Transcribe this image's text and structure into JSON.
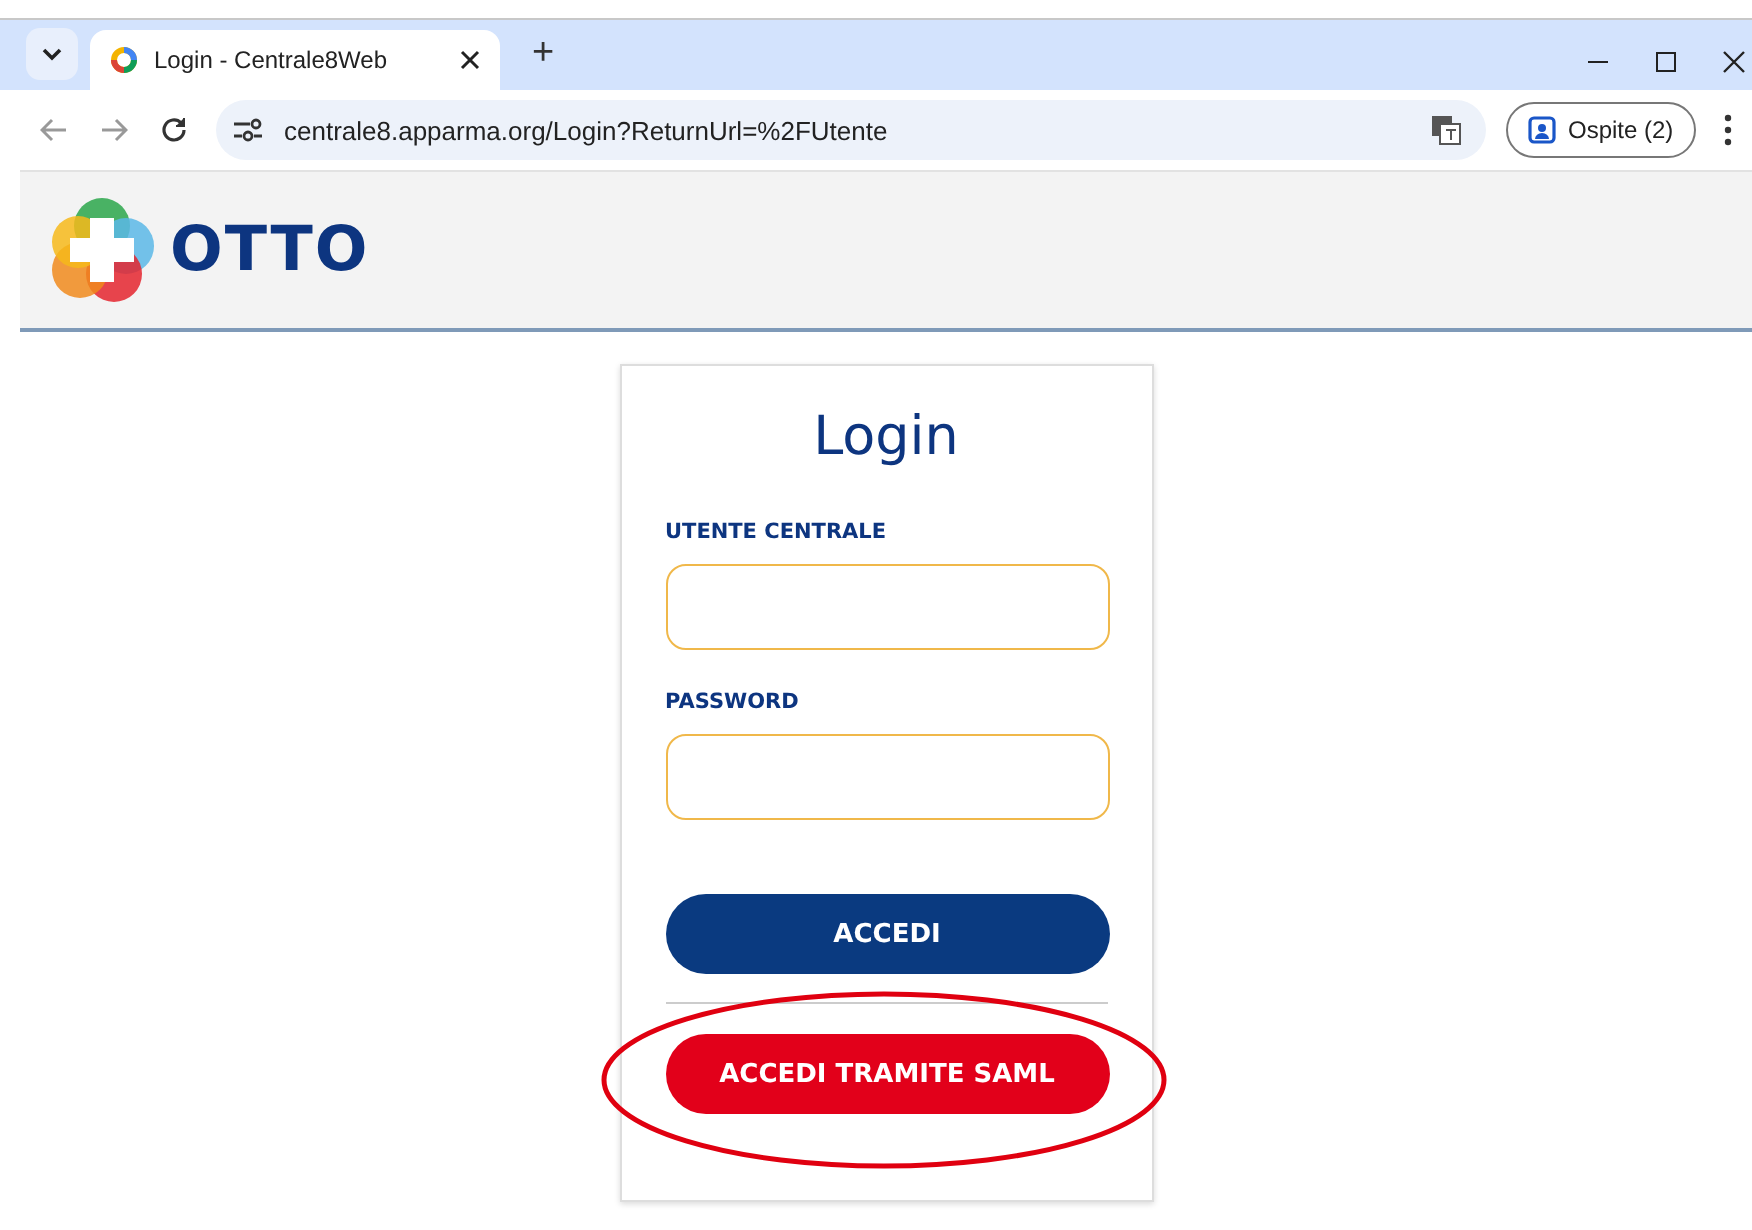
{
  "browser": {
    "tab": {
      "title": "Login - Centrale8Web",
      "selected": true
    },
    "new_tab": "+",
    "address": "centrale8.apparma.org/Login?ReturnUrl=%2FUtente",
    "profile": "Ospite (2)"
  },
  "header": {
    "logo_text": "OTTO"
  },
  "login": {
    "title": "Login",
    "fields": [
      {
        "label": "UTENTE CENTRALE"
      },
      {
        "label": "PASSWORD"
      }
    ],
    "buttons": [
      {
        "label": "ACCEDI",
        "kind": "primary",
        "highlighted": false
      },
      {
        "label": "ACCEDI TRAMITE SAML",
        "kind": "danger",
        "highlighted": true
      }
    ]
  }
}
